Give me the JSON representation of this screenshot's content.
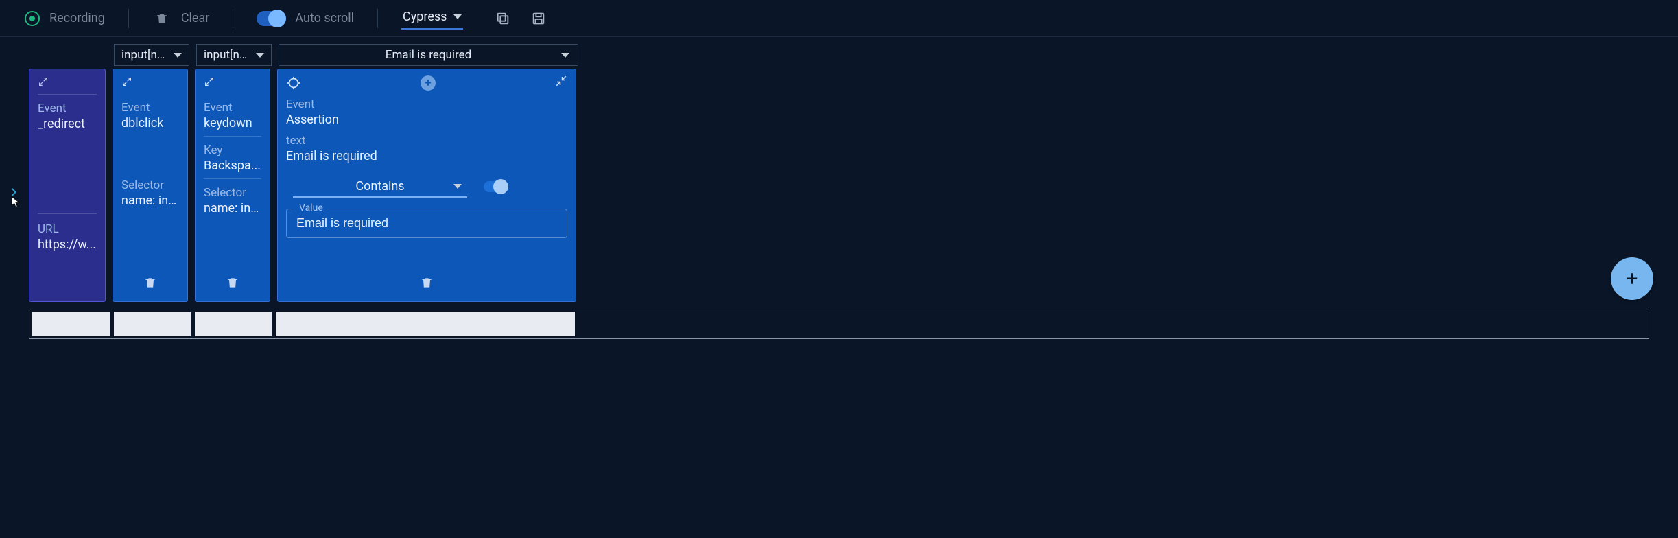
{
  "toolbar": {
    "recording_label": "Recording",
    "clear_label": "Clear",
    "autoscroll_label": "Auto scroll",
    "framework": "Cypress"
  },
  "selectors": {
    "col2": "input[n…",
    "col3": "input[n…",
    "col4": "Email is required"
  },
  "cards": [
    {
      "event_label": "Event",
      "event_value": "_redirect",
      "url_label": "URL",
      "url_value": "https://w..."
    },
    {
      "event_label": "Event",
      "event_value": "dblclick",
      "selector_label": "Selector",
      "selector_value": "name: inp..."
    },
    {
      "event_label": "Event",
      "event_value": "keydown",
      "key_label": "Key",
      "key_value": "Backspa...",
      "selector_label": "Selector",
      "selector_value": "name: inp..."
    },
    {
      "event_label": "Event",
      "event_value": "Assertion",
      "text_label": "text",
      "text_value": "Email is required",
      "match_mode": "Contains",
      "value_input_label": "Value",
      "value_input": "Email is required"
    }
  ],
  "fab_label": "+"
}
